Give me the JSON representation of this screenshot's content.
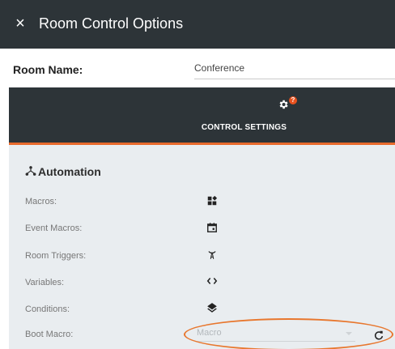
{
  "dialog": {
    "close_glyph": "×",
    "title": "Room Control Options"
  },
  "room": {
    "label": "Room Name:",
    "value": "Conference"
  },
  "tabs": [
    {
      "label": "CONTROL SETTINGS",
      "icon": "gear-icon",
      "badge": "?",
      "active": true
    }
  ],
  "automation": {
    "title": "Automation",
    "icon": "automation-nodes-icon",
    "rows": [
      {
        "label": "Macros:",
        "icon": "widgets-icon"
      },
      {
        "label": "Event Macros:",
        "icon": "calendar-icon"
      },
      {
        "label": "Room Triggers:",
        "icon": "broadcast-antenna-icon"
      },
      {
        "label": "Variables:",
        "icon": "code-brackets-icon"
      },
      {
        "label": "Conditions:",
        "icon": "layers-icon"
      }
    ],
    "boot_macro": {
      "label": "Boot Macro:",
      "placeholder": "Macro",
      "refresh_icon": "refresh-icon"
    }
  },
  "colors": {
    "header_bg": "#2d3438",
    "accent": "#e86a2c",
    "badge": "#e8521f",
    "panel_bg": "#e9edf0",
    "highlight": "#e8772e"
  }
}
